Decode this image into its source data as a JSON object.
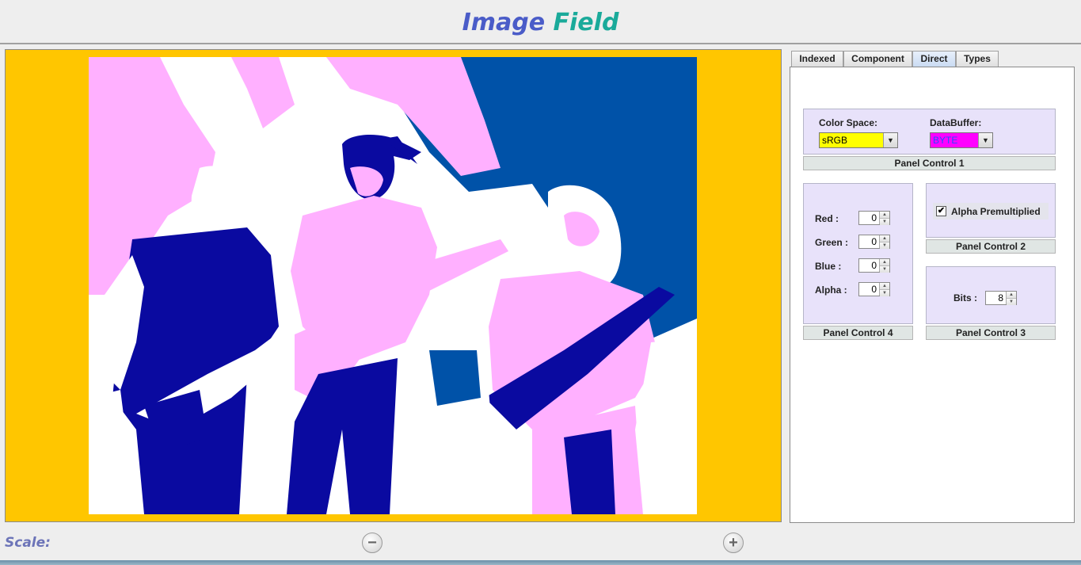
{
  "header": {
    "title_part1": "Image",
    "title_part2": "Field"
  },
  "tabs": [
    {
      "label": "Indexed",
      "active": false
    },
    {
      "label": "Component",
      "active": false
    },
    {
      "label": "Direct",
      "active": true
    },
    {
      "label": "Types",
      "active": false
    }
  ],
  "panel1": {
    "label": "Panel Control 1",
    "color_space": {
      "label": "Color Space:",
      "value": "sRGB",
      "color": "#ffff00"
    },
    "data_buffer": {
      "label": "DataBuffer:",
      "value": "BYTE",
      "color": "#ff00ff",
      "text_color": "#2a4cff"
    }
  },
  "panel2": {
    "label": "Panel Control 2",
    "alpha_premultiplied": {
      "label": "Alpha Premultiplied",
      "checked": true
    }
  },
  "panel3": {
    "label": "Panel Control 3",
    "bits": {
      "label": "Bits :",
      "value": "8"
    }
  },
  "panel4": {
    "label": "Panel Control 4",
    "red": {
      "label": "Red :",
      "value": "0"
    },
    "green": {
      "label": "Green :",
      "value": "0"
    },
    "blue": {
      "label": "Blue :",
      "value": "0"
    },
    "alpha": {
      "label": "Alpha :",
      "value": "0"
    }
  },
  "footer": {
    "scale_label": "Scale:"
  },
  "colors": {
    "image_background": "#ffc600",
    "posterized_dark": "#0a0aa0",
    "posterized_blue": "#0052a8",
    "posterized_pink": "#ffb0ff",
    "posterized_white": "#ffffff"
  },
  "icons": {
    "zoom_out": "minus-circle-icon",
    "zoom_in": "plus-circle-icon"
  }
}
